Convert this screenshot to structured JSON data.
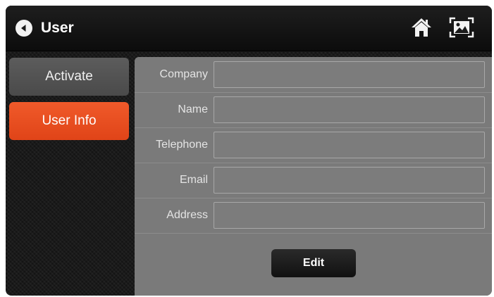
{
  "header": {
    "title": "User",
    "back_icon": "back-arrow-icon",
    "home_icon": "home-icon",
    "screenshot_icon": "screenshot-icon"
  },
  "sidebar": {
    "items": [
      {
        "label": "Activate",
        "active": false
      },
      {
        "label": "User Info",
        "active": true
      }
    ]
  },
  "form": {
    "fields": [
      {
        "label": "Company",
        "value": ""
      },
      {
        "label": "Name",
        "value": ""
      },
      {
        "label": "Telephone",
        "value": ""
      },
      {
        "label": "Email",
        "value": ""
      },
      {
        "label": "Address",
        "value": ""
      }
    ],
    "edit_label": "Edit"
  },
  "colors": {
    "accent": "#e84e1e",
    "panel": "#7a7a7a",
    "topbar": "#121212"
  }
}
